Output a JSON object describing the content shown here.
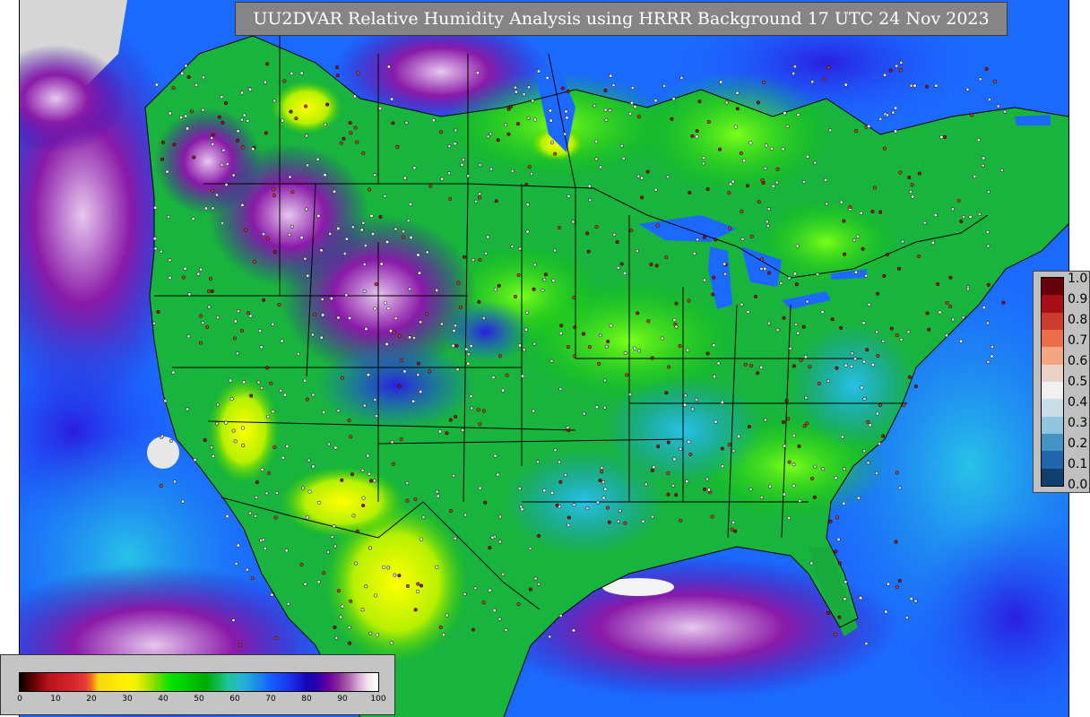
{
  "title": "UU2DVAR Relative Humidity Analysis using HRRR Background 17 UTC 24 Nov 2023",
  "rh_legend": {
    "ticks": [
      "0",
      "10",
      "20",
      "30",
      "40",
      "50",
      "60",
      "70",
      "80",
      "90",
      "100"
    ],
    "colors": [
      "#000000",
      "#b5151b",
      "#f7d90e",
      "#fff200",
      "#7ddc00",
      "#00c400",
      "#00aa00",
      "#26b4d6",
      "#1560ff",
      "#2c00a8",
      "#ffffff"
    ]
  },
  "obs_legend": {
    "ticks": [
      "1.0",
      "0.9",
      "0.8",
      "0.7",
      "0.6",
      "0.5",
      "0.4",
      "0.3",
      "0.2",
      "0.1",
      "0.0"
    ],
    "colors": [
      "#67000d",
      "#a50f15",
      "#cb3d2d",
      "#ea6e4a",
      "#f4a582",
      "#e8d3c8",
      "#f0f0f0",
      "#cadde6",
      "#92c5de",
      "#4393c3",
      "#2166ac",
      "#0f3f6e"
    ]
  },
  "palette": {
    "ocean": "#1c69ff",
    "land_moist": "#1fb34a",
    "land_dry": "#e6f000",
    "boundary": "#000000",
    "frame_gray": "#c0c0c0"
  }
}
